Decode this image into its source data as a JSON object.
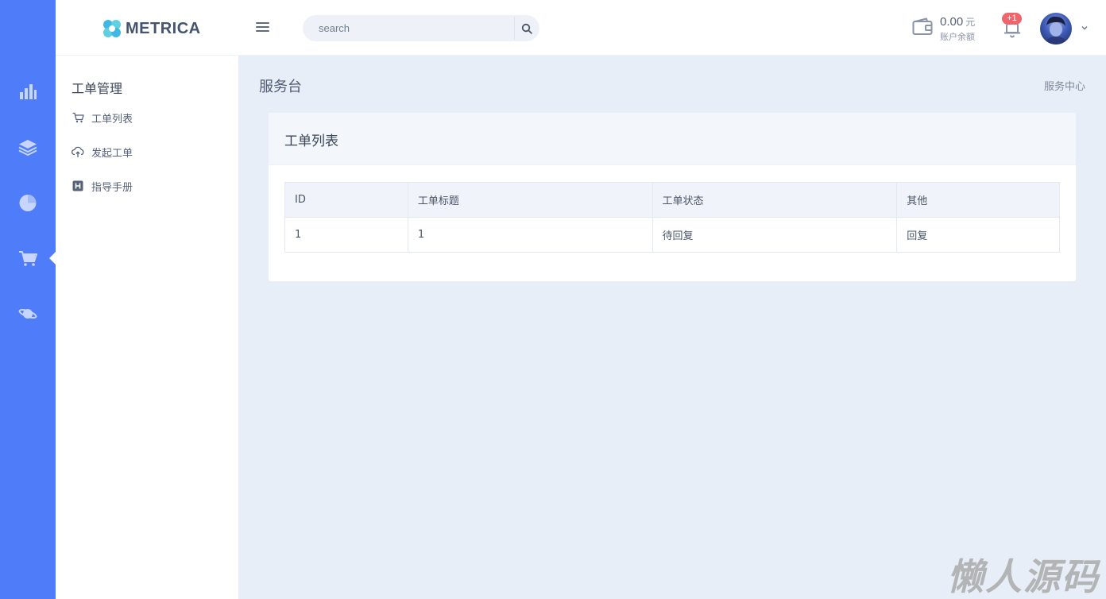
{
  "rail": {
    "items": [
      {
        "icon": "bar-chart-icon"
      },
      {
        "icon": "layers-icon"
      },
      {
        "icon": "pie-chart-icon"
      },
      {
        "icon": "cart-icon",
        "active": true
      },
      {
        "icon": "planet-icon"
      }
    ]
  },
  "header": {
    "brand": "METRICA",
    "search": {
      "placeholder": "search",
      "value": ""
    },
    "balance": {
      "amount": "0.00",
      "unit": "元",
      "label": "账户余额"
    },
    "notifications_badge": "+1"
  },
  "sidebar": {
    "title": "工单管理",
    "items": [
      {
        "label": "工单列表",
        "icon": "cart-icon"
      },
      {
        "label": "发起工单",
        "icon": "cloud-upload-icon"
      },
      {
        "label": "指导手册",
        "icon": "h-square-icon"
      }
    ]
  },
  "main": {
    "page_title": "服务台",
    "breadcrumb": "服务中心",
    "card_title": "工单列表",
    "table": {
      "columns": [
        "ID",
        "工单标题",
        "工单状态",
        "其他"
      ],
      "rows": [
        [
          "1",
          "1",
          "待回复",
          "回复"
        ]
      ]
    }
  },
  "watermark": "懒人源码",
  "colors": {
    "rail": "#4f7cf8",
    "background": "#e8eef7",
    "badge": "#f1646c",
    "brand_accent": "#3fb8e6"
  }
}
